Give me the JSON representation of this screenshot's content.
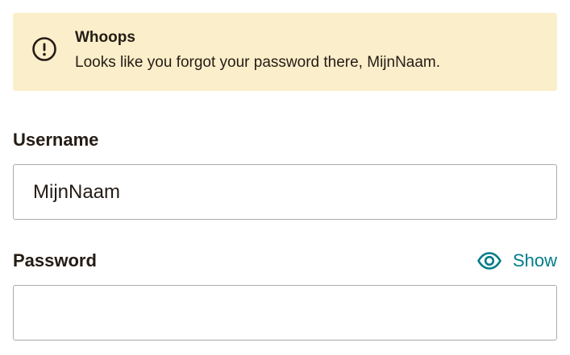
{
  "alert": {
    "icon": "alert-circle-icon",
    "title": "Whoops",
    "message": "Looks like you forgot your password there, MijnNaam.",
    "background_color": "#fbeeca"
  },
  "username": {
    "label": "Username",
    "value": "MijnNaam"
  },
  "password": {
    "label": "Password",
    "value": "",
    "toggle_label": "Show",
    "toggle_icon": "eye-icon",
    "toggle_color": "#007c89"
  }
}
